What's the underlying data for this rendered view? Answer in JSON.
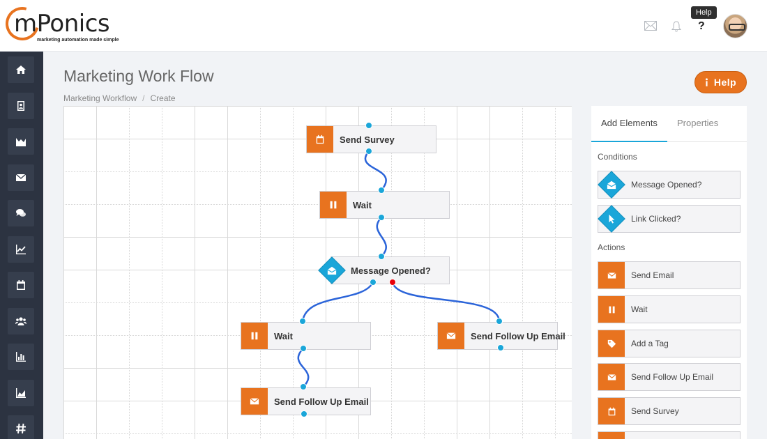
{
  "brand": {
    "name": "mPonics",
    "tagline": "marketing automation made simple"
  },
  "header": {
    "icons": [
      "mail-icon",
      "bell-icon",
      "question-icon"
    ],
    "tooltip": "Help",
    "help_glyph": "?"
  },
  "sidebar": {
    "items": [
      {
        "name": "home",
        "icon": "home-icon"
      },
      {
        "name": "contacts",
        "icon": "contact-card-icon"
      },
      {
        "name": "analytics",
        "icon": "area-chart-icon"
      },
      {
        "name": "email",
        "icon": "envelope-icon"
      },
      {
        "name": "chat",
        "icon": "chat-bubbles-icon"
      },
      {
        "name": "trends",
        "icon": "line-chart-icon"
      },
      {
        "name": "calendar",
        "icon": "calendar-icon"
      },
      {
        "name": "users",
        "icon": "users-icon"
      },
      {
        "name": "reports",
        "icon": "bar-chart-icon"
      },
      {
        "name": "stats",
        "icon": "mountain-chart-icon"
      },
      {
        "name": "hashtags",
        "icon": "hash-icon"
      }
    ]
  },
  "page": {
    "title": "Marketing Work Flow",
    "breadcrumb": [
      "Marketing Workflow",
      "Create"
    ],
    "help_button": "Help"
  },
  "workflow": {
    "nodes": [
      {
        "id": "send-survey",
        "label": "Send Survey",
        "kind": "action",
        "icon": "calendar-icon"
      },
      {
        "id": "wait-1",
        "label": "Wait",
        "kind": "action",
        "icon": "pause-icon"
      },
      {
        "id": "message-opened",
        "label": "Message Opened?",
        "kind": "condition",
        "icon": "open-envelope-icon"
      },
      {
        "id": "wait-2",
        "label": "Wait",
        "kind": "action",
        "icon": "pause-icon"
      },
      {
        "id": "send-follow-up-right",
        "label": "Send Follow Up Email",
        "kind": "action",
        "icon": "envelope-icon"
      },
      {
        "id": "send-follow-up-bottom",
        "label": "Send Follow Up Email",
        "kind": "action",
        "icon": "envelope-icon"
      }
    ],
    "colors": {
      "action": "#e8731f",
      "condition": "#1aa6d9",
      "wire": "#2b64d9",
      "active_port": "#e8000b"
    }
  },
  "panel": {
    "tabs": [
      "Add Elements",
      "Properties"
    ],
    "active_tab": "Add Elements",
    "conditions_heading": "Conditions",
    "conditions": [
      {
        "label": "Message Opened?",
        "icon": "open-envelope-icon"
      },
      {
        "label": "Link Clicked?",
        "icon": "cursor-icon"
      }
    ],
    "actions_heading": "Actions",
    "actions": [
      {
        "label": "Send Email",
        "icon": "envelope-icon"
      },
      {
        "label": "Wait",
        "icon": "pause-icon"
      },
      {
        "label": "Add a Tag",
        "icon": "tag-icon"
      },
      {
        "label": "Send Follow Up Email",
        "icon": "envelope-icon"
      },
      {
        "label": "Send Survey",
        "icon": "calendar-icon"
      }
    ]
  }
}
